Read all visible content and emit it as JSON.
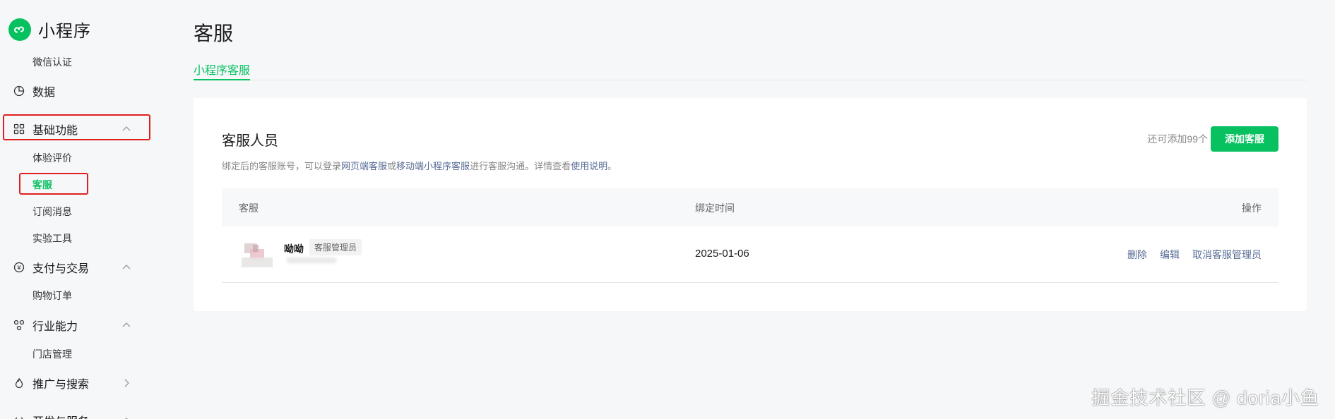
{
  "brand": {
    "name": "小程序",
    "color": "#07c160"
  },
  "sidebar": {
    "items": [
      {
        "type": "sub",
        "label": "微信认证"
      },
      {
        "type": "group",
        "label": "数据",
        "icon": "pie-chart-icon"
      },
      {
        "type": "group",
        "label": "基础功能",
        "icon": "grid-icon",
        "expanded": true,
        "highlighted": true
      },
      {
        "type": "sub",
        "label": "体验评价"
      },
      {
        "type": "sub",
        "label": "客服",
        "active": true,
        "highlighted": true
      },
      {
        "type": "sub",
        "label": "订阅消息"
      },
      {
        "type": "sub",
        "label": "实验工具"
      },
      {
        "type": "group",
        "label": "支付与交易",
        "icon": "yen-circle-icon",
        "expanded": true
      },
      {
        "type": "sub",
        "label": "购物订单"
      },
      {
        "type": "group",
        "label": "行业能力",
        "icon": "nodes-icon",
        "expanded": true
      },
      {
        "type": "sub",
        "label": "门店管理"
      },
      {
        "type": "group",
        "label": "推广与搜索",
        "icon": "flame-icon",
        "expanded": false
      },
      {
        "type": "group",
        "label": "开发与服务",
        "icon": "code-icon",
        "expanded": true
      }
    ]
  },
  "page": {
    "title": "客服",
    "tabs": [
      {
        "label": "小程序客服",
        "active": true
      }
    ]
  },
  "card": {
    "title": "客服人员",
    "desc_prefix": "绑定后的客服账号，可以登录",
    "desc_link1": "网页端客服",
    "desc_mid": "或",
    "desc_link2": "移动端小程序客服",
    "desc_suffix": "进行客服沟通。详情查看",
    "desc_link3": "使用说明",
    "desc_end": "。",
    "remaining": "还可添加99个",
    "add_button": "添加客服"
  },
  "table": {
    "columns": [
      "客服",
      "绑定时间",
      "操作"
    ],
    "rows": [
      {
        "name": "呦呦",
        "role": "客服管理员",
        "bind_time": "2025-01-06",
        "actions": [
          "删除",
          "编辑",
          "取消客服管理员"
        ]
      }
    ]
  },
  "watermark": "掘金技术社区 @ doria小鱼",
  "colors": {
    "accent": "#07c160",
    "link": "#576b95",
    "annotation": "#e02020"
  }
}
